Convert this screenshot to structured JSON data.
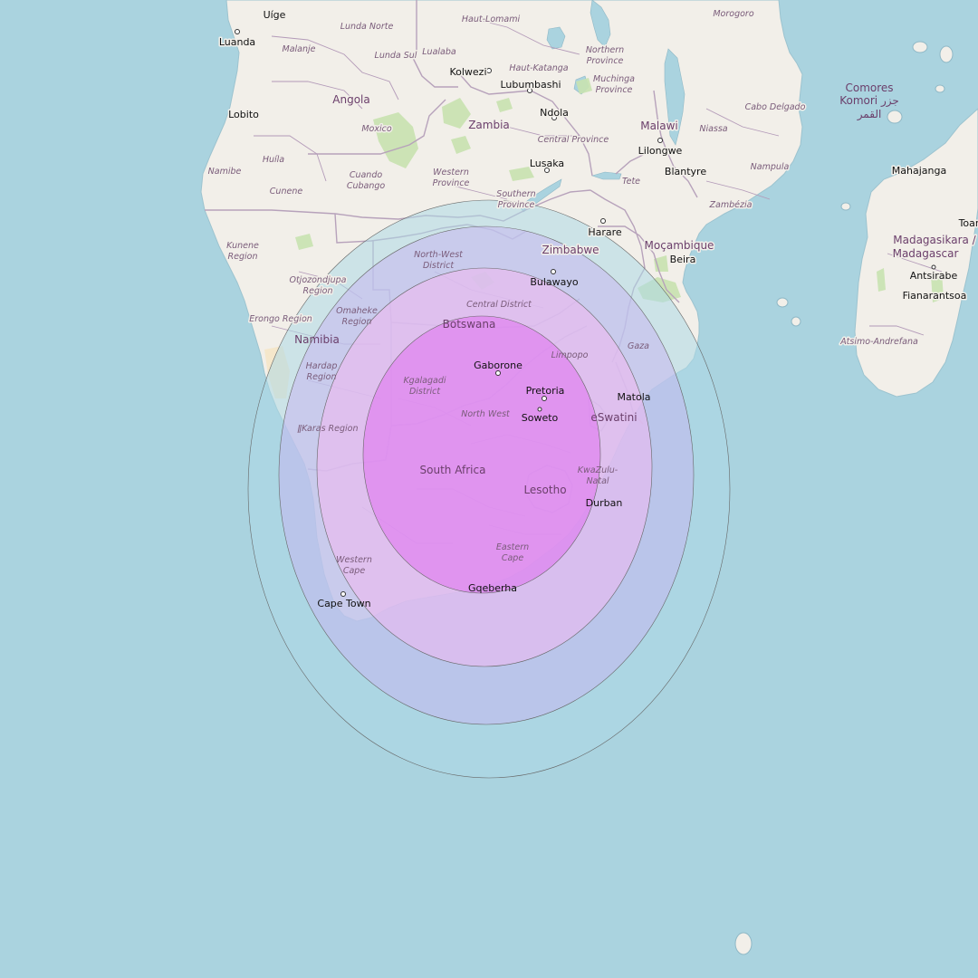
{
  "colors": {
    "sea": "#aad3df",
    "land": "#f2efe9",
    "lake": "#aad3df",
    "park": "#c8e2b0",
    "border": "#b39ab8",
    "ring_outer": "#add8e6",
    "ring_blue": "#c7b8f0",
    "ring_pink": "#f0b8f0",
    "ring_inner": "#e070f0"
  },
  "coverage_rings": [
    {
      "name": "footprint-ring-1",
      "opacity": 0.55
    },
    {
      "name": "footprint-ring-2",
      "opacity": 0.55
    },
    {
      "name": "footprint-ring-3",
      "opacity": 0.55
    },
    {
      "name": "footprint-ring-4",
      "opacity": 0.55
    }
  ],
  "labels": {
    "countries": {
      "angola": "Angola",
      "zambia": "Zambia",
      "malawi": "Malawi",
      "namibia": "Namibia",
      "botswana": "Botswana",
      "zimbabwe": "Zimbabwe",
      "mozambique": "Moçambique",
      "south_africa": "South Africa",
      "lesotho": "Lesotho",
      "eswatini": "eSwatini",
      "madagascar_1": "Madagasikara /",
      "madagascar_2": "Madagascar",
      "comores_1": "Comores",
      "comores_2": "Komori جزر",
      "comores_3": "القمر"
    },
    "cities": {
      "uige": "Uíge",
      "luanda": "Luanda",
      "lobito": "Lobito",
      "kolwezi": "Kolwezi",
      "lubumbashi": "Lubumbashi",
      "ndola": "Ndola",
      "lusaka": "Lusaka",
      "lilongwe": "Lilongwe",
      "blantyre": "Blantyre",
      "harare": "Harare",
      "beira": "Beira",
      "bulawayo": "Bulawayo",
      "gaborone": "Gaborone",
      "pretoria": "Pretoria",
      "soweto": "Soweto",
      "matola": "Matola",
      "durban": "Durban",
      "gqeberha": "Gqeberha",
      "cape_town": "Cape Town",
      "mahajanga": "Mahajanga",
      "antsirabe": "Antsirabe",
      "fianarantsoa": "Fianarantsoa",
      "toamasina": "Toar"
    },
    "regions": {
      "lunda_norte": "Lunda Norte",
      "malanje": "Malanje",
      "lunda_sul": "Lunda Sul",
      "lualaba": "Lualaba",
      "haut_lomami": "Haut-Lomami",
      "haut_katanga": "Haut-Katanga",
      "morogoro": "Morogoro",
      "northern_province_1": "Northern",
      "northern_province_2": "Province",
      "muchinga_1": "Muchinga",
      "muchinga_2": "Province",
      "cabo_delgado": "Cabo Delgado",
      "niassa": "Niassa",
      "moxico": "Moxico",
      "central_province": "Central Province",
      "huila": "Huíla",
      "namibe": "Namibe",
      "cunene": "Cunene",
      "cuando_1": "Cuando",
      "cuando_2": "Cubango",
      "western_province_1": "Western",
      "western_province_2": "Province",
      "southern_province_1": "Southern",
      "southern_province_2": "Province",
      "tete": "Tete",
      "nampula": "Nampula",
      "zambezia": "Zambézia",
      "kunene_1": "Kunene",
      "kunene_2": "Region",
      "otjozondjupa_1": "Otjozondjupa",
      "otjozondjupa_2": "Region",
      "north_west_district_1": "North-West",
      "north_west_district_2": "District",
      "central_district": "Central District",
      "erongo": "Erongo Region",
      "omaheke_1": "Omaheke",
      "omaheke_2": "Region",
      "hardap_1": "Hardap",
      "hardap_2": "Region",
      "kgalagadi_1": "Kgalagadi",
      "kgalagadi_2": "District",
      "limpopo": "Limpopo",
      "gaza": "Gaza",
      "north_west": "North West",
      "ilkaras": "ǁKaras Region",
      "kwazulu_1": "KwaZulu-",
      "kwazulu_2": "Natal",
      "eastern_cape_1": "Eastern",
      "eastern_cape_2": "Cape",
      "western_cape_1": "Western",
      "western_cape_2": "Cape",
      "atsimo_andrefana": "Atsimo-Andrefana"
    }
  }
}
